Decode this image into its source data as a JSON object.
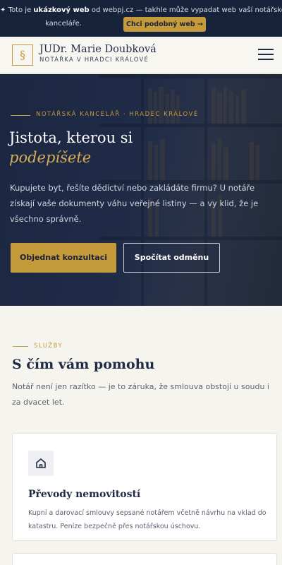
{
  "promo": {
    "prefix": "✦ Toto je ",
    "highlight": "ukázkový web",
    "suffix": " od webpj.cz — takhle může vypadat web vaší notářské",
    "line2": "kanceláře.",
    "button": "Chci podobný web →"
  },
  "header": {
    "logo_symbol": "§",
    "name": "JUDr. Marie Doubková",
    "subtitle": "NOTÁŘKA V HRADCI KRÁLOVÉ"
  },
  "hero": {
    "eyebrow": "NOTÁŘSKÁ KANCELÁŘ · HRADEC KRÁLOVÉ",
    "title_line1": "Jistota, kterou si",
    "title_line2": "podepíšete",
    "paragraph": "Kupujete byt, řešíte dědictví nebo zakládáte firmu? U notáře získají vaše dokumenty váhu veřejné listiny — a vy klid, že je všechno správně.",
    "primary_button": "Objednat konzultaci",
    "secondary_button": "Spočítat odměnu"
  },
  "services": {
    "eyebrow": "SLUŽBY",
    "title": "S čím vám pomohu",
    "intro": "Notář není jen razítko — je to záruka, že smlouva obstojí u soudu i za dvacet let.",
    "cards": [
      {
        "icon": "home-icon",
        "title": "Převody nemovitostí",
        "text": "Kupní a darovací smlouvy sepsané notářem včetně návrhu na vklad do katastru. Peníze bezpečně přes notářskou úschovu."
      }
    ]
  },
  "colors": {
    "navy": "#17223b",
    "gold": "#c59a3a",
    "cream": "#f6f4ef"
  }
}
